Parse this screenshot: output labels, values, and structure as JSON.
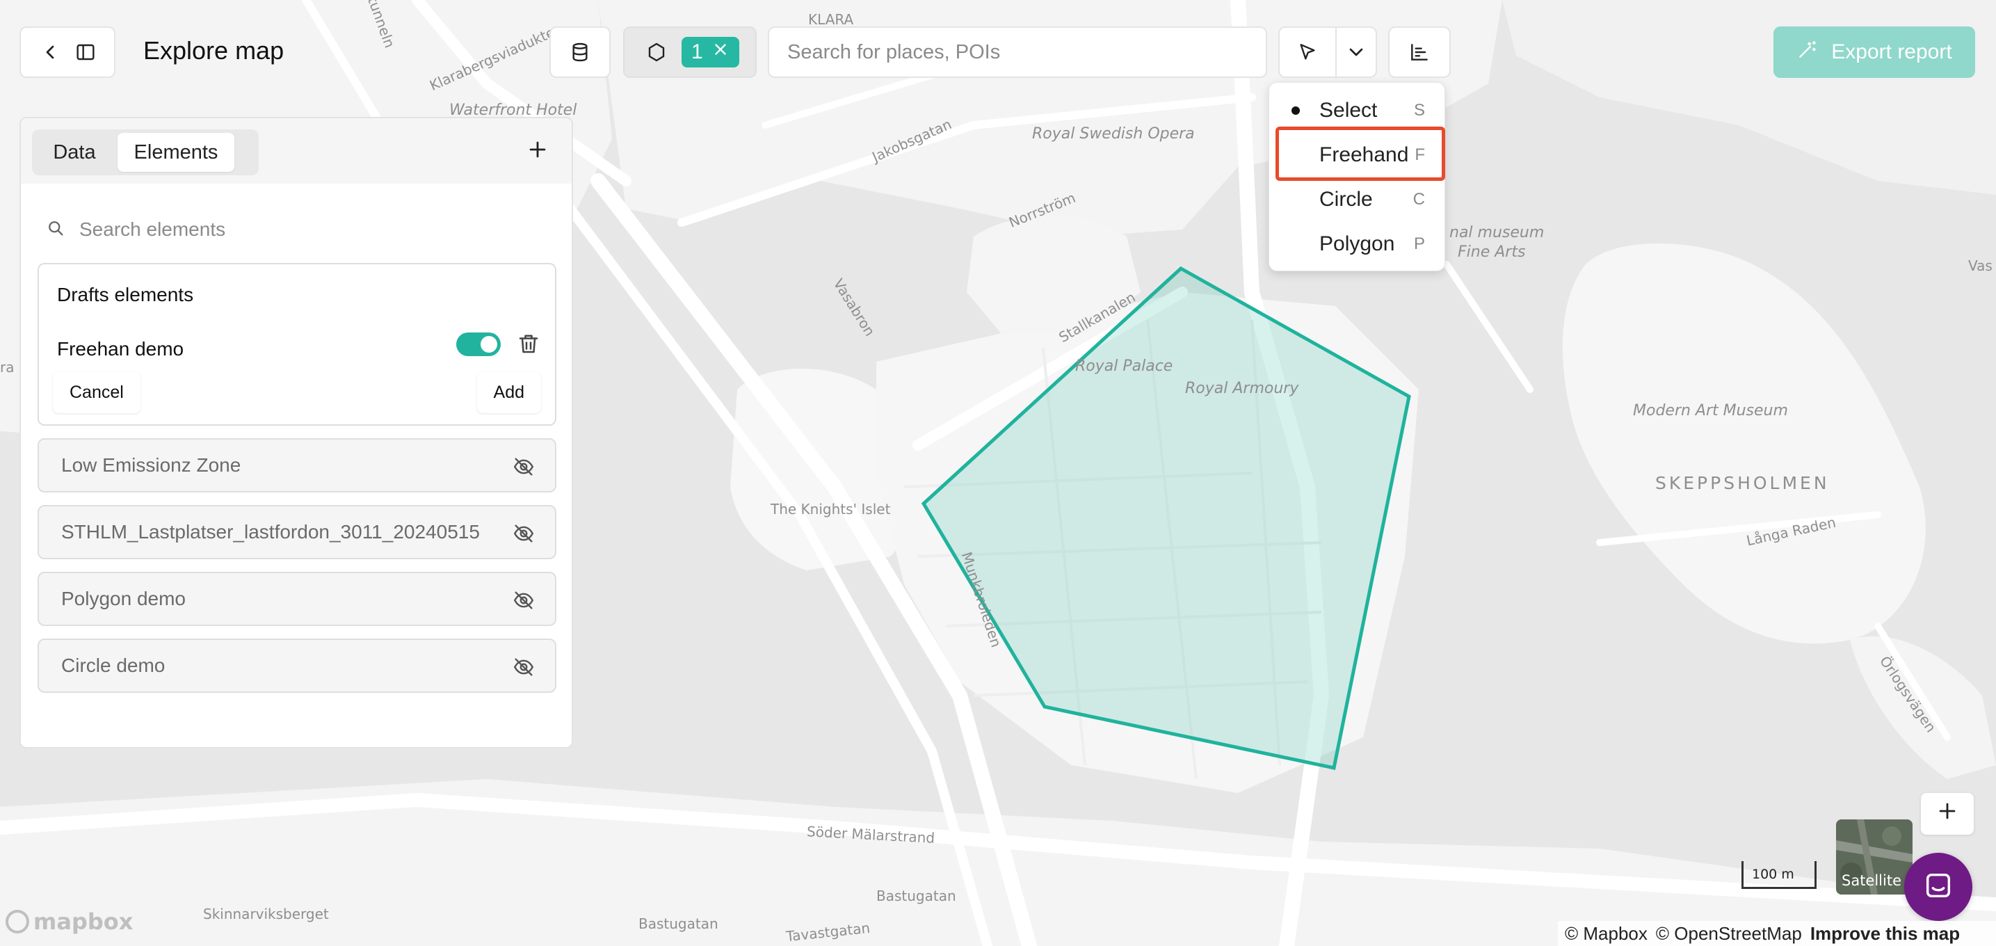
{
  "header": {
    "title": "Explore map",
    "layer_count": "1",
    "search_placeholder": "Search for places, POIs",
    "export_label": "Export report"
  },
  "draw_menu": {
    "items": [
      {
        "label": "Select",
        "key": "S",
        "selected": true
      },
      {
        "label": "Freehand",
        "key": "F",
        "selected": false
      },
      {
        "label": "Circle",
        "key": "C",
        "selected": false
      },
      {
        "label": "Polygon",
        "key": "P",
        "selected": false
      }
    ]
  },
  "panel": {
    "tabs": [
      {
        "label": "Data"
      },
      {
        "label": "Elements"
      }
    ],
    "active_tab": "Elements",
    "search_placeholder": "Search elements",
    "drafts": {
      "title": "Drafts elements",
      "item_name": "Freehan demo",
      "toggle_on": true,
      "cancel_label": "Cancel",
      "add_label": "Add"
    },
    "layers": [
      {
        "name": "Low Emissionz Zone"
      },
      {
        "name": "STHLM_Lastplatser_lastfordon_3011_20240515"
      },
      {
        "name": "Polygon demo"
      },
      {
        "name": "Circle demo"
      }
    ]
  },
  "map": {
    "labels": {
      "klara": "KLARA",
      "klarabergsviadukten": "Klarabergsviadukten",
      "tunneln": "tunneln",
      "waterfront": "Waterfront Hotel",
      "jakobsgatan": "Jakobsgatan",
      "opera": "Royal Swedish Opera",
      "norrstrom": "Norrström",
      "vasabron": "Vasabron",
      "stallkanalen": "Stallkanalen",
      "palace": "Royal Palace",
      "armoury": "Royal Armoury",
      "knights": "The Knights' Islet",
      "munkbroleden": "Munkbroleden",
      "museum_fine": "nal museum",
      "fine_arts": "Fine Arts",
      "modern_art": "Modern Art Museum",
      "skeppsholmen": "SKEPPSHOLMEN",
      "langa_raden": "Långa Raden",
      "orlogsvagen": "Örlogsvägen",
      "soder": "Söder Mälarstrand",
      "bastugatan1": "Bastugatan",
      "bastugatan2": "Bastugatan",
      "tavastgatan": "Tavastgatan",
      "skinnarviksberget": "Skinnarviksberget",
      "vas": "Vas",
      "ra": "ra"
    },
    "polygon_color": "#1fb39c",
    "scale_label": "100 m",
    "satellite_label": "Satellite",
    "attribution": {
      "mapbox": "© Mapbox",
      "osm": "© OpenStreetMap",
      "improve": "Improve this map"
    },
    "logo_text": "mapbox"
  }
}
